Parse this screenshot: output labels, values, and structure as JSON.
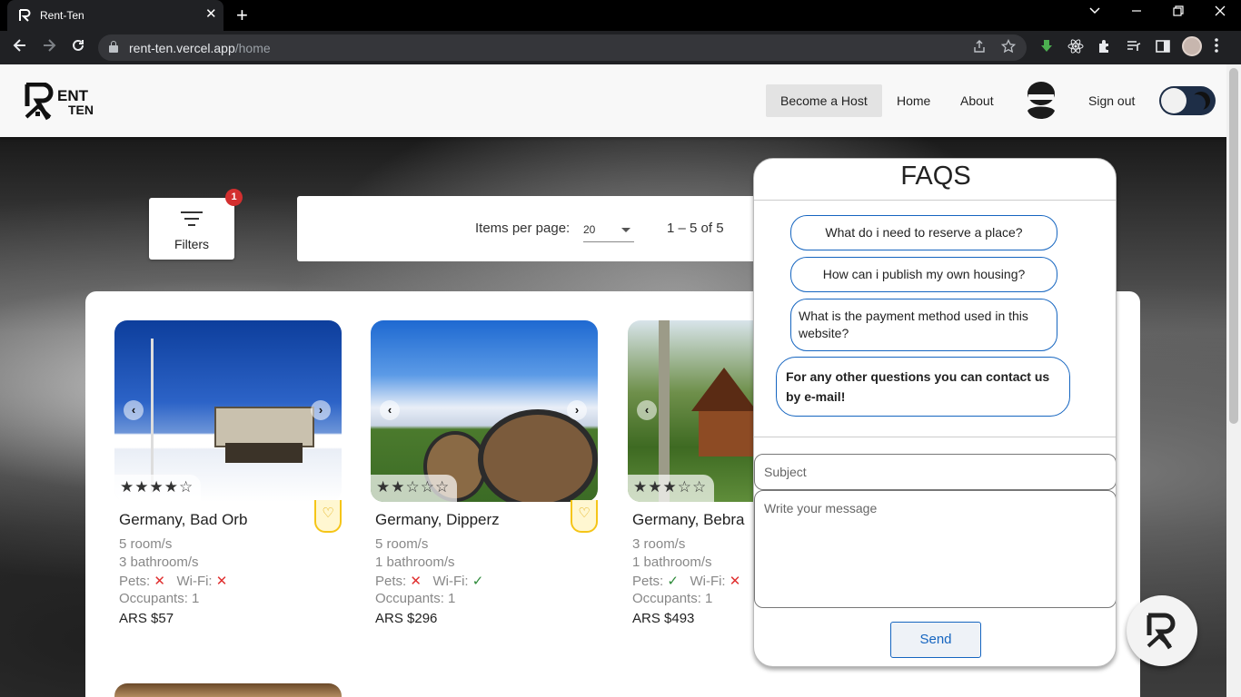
{
  "browser": {
    "tab_title": "Rent-Ten",
    "tab_close": "✕",
    "new_tab": "+",
    "url_host": "rent-ten.vercel.app",
    "url_path": "/home",
    "icons": [
      "back-icon",
      "forward-icon",
      "reload-icon",
      "share-icon",
      "star-icon",
      "download-icon",
      "react-icon",
      "extensions-icon",
      "media-icon",
      "sidebar-icon",
      "profile-avatar",
      "menu-icon"
    ]
  },
  "header": {
    "logo_text": "RENT TEN",
    "nav": {
      "become_host": "Become a Host",
      "home": "Home",
      "about": "About",
      "sign_out": "Sign out"
    }
  },
  "filters": {
    "label": "Filters",
    "badge_count": "1"
  },
  "pager": {
    "label": "Items per page:",
    "per_page": "20",
    "range": "1 – 5 of 5"
  },
  "cards": [
    {
      "title": "Germany, Bad Orb",
      "rooms": "5 room/s",
      "bathrooms": "3 bathroom/s",
      "pets_label": "Pets:",
      "pets_mark": "✕",
      "wifi_label": "Wi-Fi:",
      "wifi_mark": "✕",
      "occupants": "Occupants: 1",
      "price": "ARS $57",
      "stars": "★★★★☆",
      "rating": 4
    },
    {
      "title": "Germany, Dipperz",
      "rooms": "5 room/s",
      "bathrooms": "1 bathroom/s",
      "pets_label": "Pets:",
      "pets_mark": "✕",
      "wifi_label": "Wi-Fi:",
      "wifi_mark": "✓",
      "occupants": "Occupants: 1",
      "price": "ARS $296",
      "stars": "★★☆☆☆",
      "rating": 2
    },
    {
      "title": "Germany, Bebra",
      "rooms": "3 room/s",
      "bathrooms": "1 bathroom/s",
      "pets_label": "Pets:",
      "pets_mark": "✓",
      "wifi_label": "Wi-Fi:",
      "wifi_mark": "✕",
      "occupants": "Occupants: 1",
      "price": "ARS $493",
      "stars": "★★★☆☆",
      "rating": 3
    }
  ],
  "faq": {
    "title": "FAQS",
    "questions": [
      "What do i need to reserve a place?",
      "How can i publish my own housing?",
      "What is the payment method used in this website?"
    ],
    "contact": "For any other questions you can contact us by e-mail!",
    "subject_placeholder": "Subject",
    "message_placeholder": "Write your message",
    "send_label": "Send"
  },
  "colors": {
    "accent_blue": "#1565c0",
    "badge_red": "#d32f2f",
    "favorite_yellow": "#f5c518",
    "toggle_dark": "#1e2e47"
  }
}
